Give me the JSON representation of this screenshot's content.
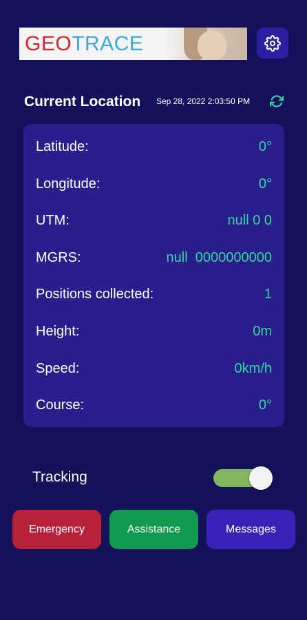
{
  "logo": {
    "part1": "GEO",
    "part2": "TRACE",
    "colors": {
      "geo": "#d7242b",
      "trace": "#3aa7e0"
    }
  },
  "header": {
    "title": "Current Location",
    "timestamp": "Sep 28, 2022 2:03:50 PM",
    "settings_icon": "gear-icon",
    "refresh_icon": "refresh-icon"
  },
  "location": {
    "rows": [
      {
        "label": "Latitude:",
        "value": "0°"
      },
      {
        "label": "Longitude:",
        "value": "0°"
      },
      {
        "label": "UTM:",
        "value": "null 0 0"
      },
      {
        "label": "MGRS:",
        "value": "null  0000000000"
      },
      {
        "label": "Positions collected:",
        "value": "1"
      },
      {
        "label": "Height:",
        "value": "0m"
      },
      {
        "label": "Speed:",
        "value": "0km/h"
      },
      {
        "label": "Course:",
        "value": "0°"
      }
    ]
  },
  "tracking": {
    "label": "Tracking",
    "enabled": true
  },
  "actions": {
    "emergency": "Emergency",
    "assistance": "Assistance",
    "messages": "Messages"
  },
  "colors": {
    "background": "#15115a",
    "card": "#2a1d8c",
    "value_text": "#35d5a1",
    "emergency": "#b8213a",
    "assistance": "#0f9a50",
    "messages": "#3a22b8"
  }
}
